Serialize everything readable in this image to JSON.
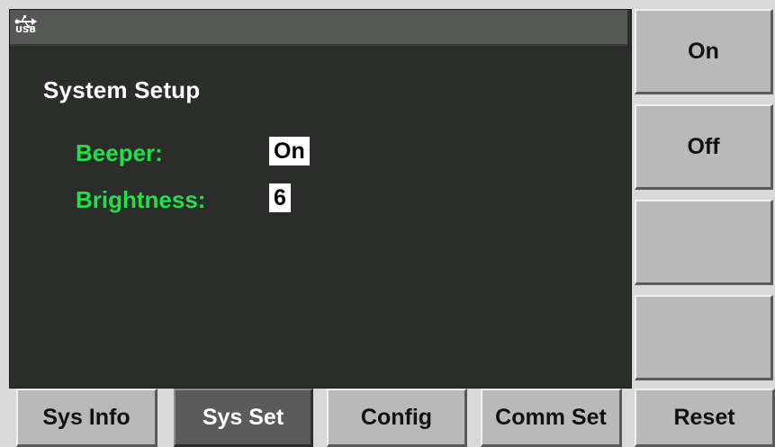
{
  "status_bar": {
    "usb_icon": "usb-icon",
    "usb_label": "USB"
  },
  "main": {
    "title": "System Setup",
    "fields": [
      {
        "label": "Beeper:",
        "value": "On"
      },
      {
        "label": "Brightness:",
        "value": "6"
      }
    ]
  },
  "softkeys": [
    {
      "label": "On"
    },
    {
      "label": "Off"
    },
    {
      "label": ""
    },
    {
      "label": ""
    }
  ],
  "bottom_tabs": [
    {
      "label": "Sys Info",
      "active": false
    },
    {
      "label": "Sys Set",
      "active": true
    },
    {
      "label": "Config",
      "active": false
    },
    {
      "label": "Comm Set",
      "active": false
    }
  ],
  "reset_label": "Reset",
  "colors": {
    "screen_bg": "#2b2d2a",
    "label_green": "#23e04a",
    "active_tab": "#5b5b5b",
    "button_gray": "#b9b9b9"
  }
}
